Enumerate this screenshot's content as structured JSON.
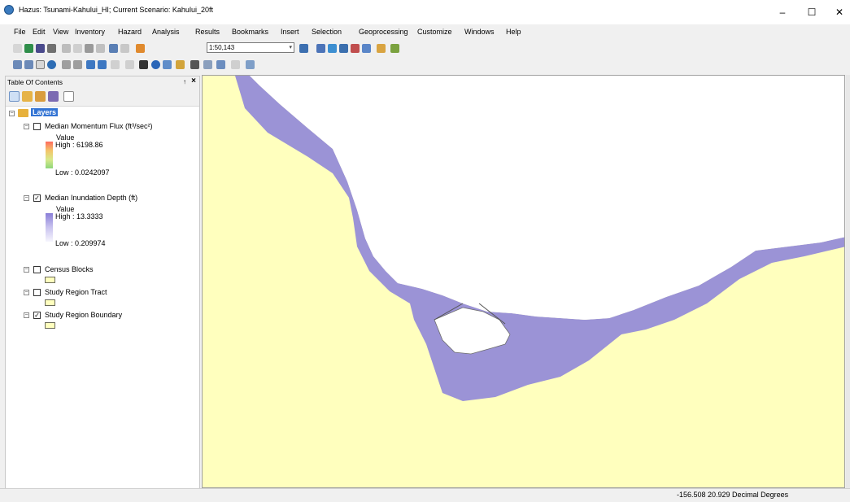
{
  "window": {
    "title": "Hazus: Tsunami-Kahului_HI; Current Scenario: Kahului_20ft",
    "minimize": "–",
    "maximize": "☐",
    "close": "✕"
  },
  "menu": [
    "File",
    "Edit",
    "View",
    "Inventory",
    "Hazard",
    "Analysis",
    "Results",
    "Bookmarks",
    "Insert",
    "Selection",
    "Geoprocessing",
    "Customize",
    "Windows",
    "Help"
  ],
  "toolbar": {
    "scale": "1:50,143"
  },
  "toc": {
    "title": "Table Of Contents",
    "pin": "↑",
    "close": "×",
    "root": "Layers",
    "layers": [
      {
        "name": "Median Momentum Flux (ft³/sec²)",
        "checked": false,
        "value_header": "Value",
        "high": "High : 6198.86",
        "low": "Low : 0.0242097"
      },
      {
        "name": "Median Inundation Depth (ft)",
        "checked": true,
        "value_header": "Value",
        "high": "High : 13.3333",
        "low": "Low : 0.209974"
      },
      {
        "name": "Census Blocks",
        "checked": false
      },
      {
        "name": "Study Region Tract",
        "checked": false
      },
      {
        "name": "Study Region Boundary",
        "checked": true
      }
    ]
  },
  "status": {
    "coords": "-156.508  20.929 Decimal Degrees"
  },
  "colors": {
    "land": "#ffffbe",
    "inundation": "#9b93d6",
    "ocean": "#ffffff"
  }
}
